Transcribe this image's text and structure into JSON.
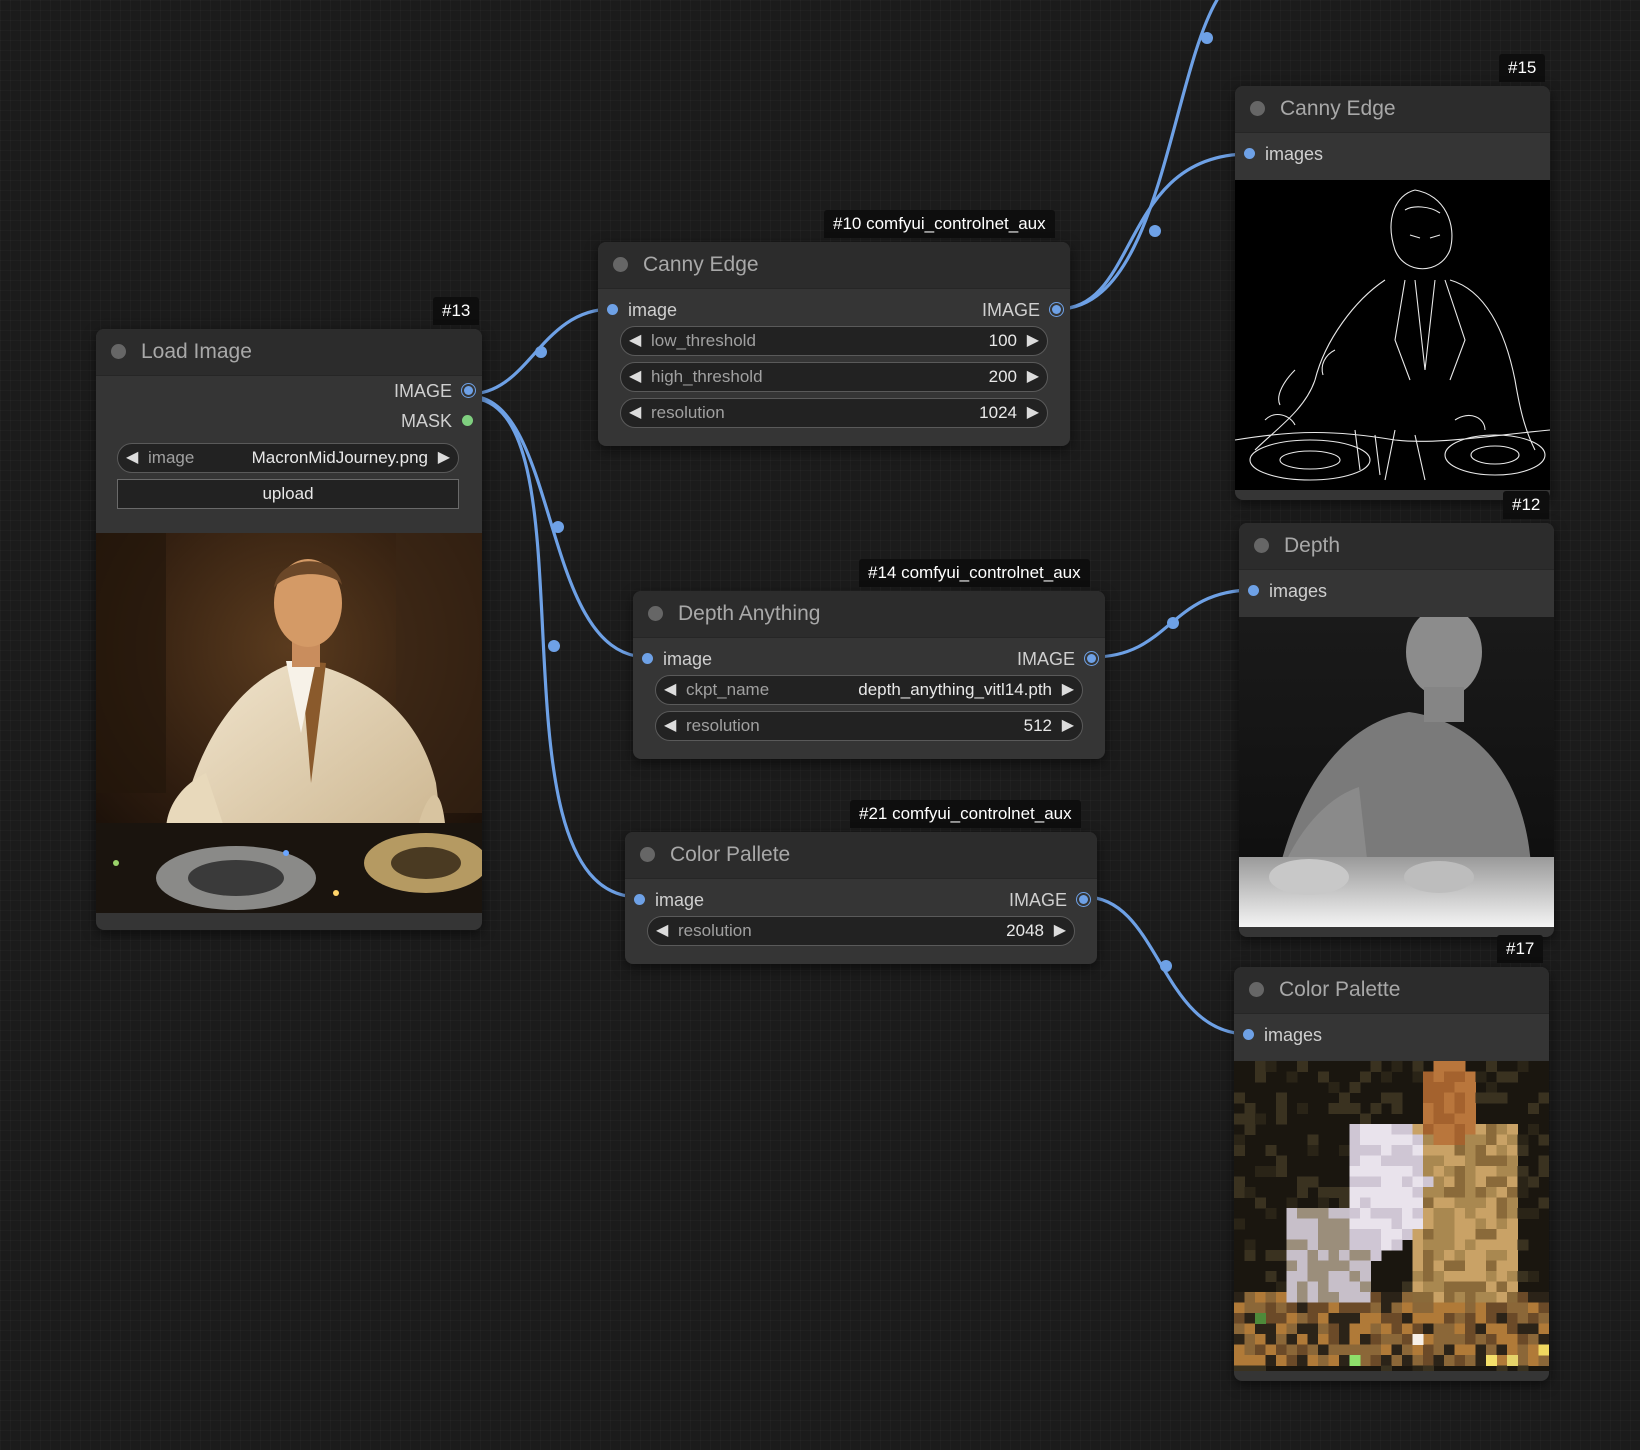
{
  "colors": {
    "canvas": "#1b1b1b",
    "node_body": "#353535",
    "node_title": "#2c2c2c",
    "link": "#6ea1e6",
    "mask_pin": "#7fcf7f"
  },
  "nodes": {
    "load_image": {
      "badge": "#13",
      "title": "Load Image",
      "outputs": [
        "IMAGE",
        "MASK"
      ],
      "widget_image": {
        "label": "image",
        "value": "MacronMidJourney.png"
      },
      "upload_label": "upload"
    },
    "canny_edge": {
      "badge": "#10 comfyui_controlnet_aux",
      "title": "Canny Edge",
      "input": "image",
      "output": "IMAGE",
      "widgets": [
        {
          "label": "low_threshold",
          "value": "100"
        },
        {
          "label": "high_threshold",
          "value": "200"
        },
        {
          "label": "resolution",
          "value": "1024"
        }
      ]
    },
    "depth_anything": {
      "badge": "#14 comfyui_controlnet_aux",
      "title": "Depth Anything",
      "input": "image",
      "output": "IMAGE",
      "widgets": [
        {
          "label": "ckpt_name",
          "value": "depth_anything_vitl14.pth"
        },
        {
          "label": "resolution",
          "value": "512"
        }
      ]
    },
    "color_pallete": {
      "badge": "#21 comfyui_controlnet_aux",
      "title": "Color Pallete",
      "input": "image",
      "output": "IMAGE",
      "widgets": [
        {
          "label": "resolution",
          "value": "2048"
        }
      ]
    },
    "preview_canny": {
      "badge": "#15",
      "title": "Canny Edge",
      "input": "images"
    },
    "preview_depth": {
      "badge": "#12",
      "title": "Depth",
      "input": "images"
    },
    "preview_palette": {
      "badge": "#17",
      "title": "Color Palette",
      "input": "images"
    }
  }
}
